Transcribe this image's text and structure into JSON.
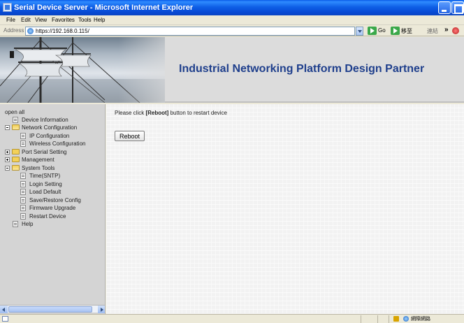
{
  "window": {
    "title": "Serial Device Server - Microsoft Internet Explorer"
  },
  "menu": [
    "File",
    "Edit",
    "View",
    "Favorites",
    "Tools",
    "Help"
  ],
  "address": {
    "label": "Address",
    "url": "https://192.168.0.115/",
    "go_label": "Go",
    "go2_label": "移至",
    "links_label": "連結"
  },
  "banner": {
    "title": "Industrial Networking Platform Design Partner"
  },
  "sidebar": {
    "items": [
      {
        "label": "open all",
        "kind": "text"
      },
      {
        "label": "Device Information",
        "kind": "page"
      },
      {
        "label": "Network Configuration",
        "kind": "folder-open"
      },
      {
        "label": "IP Configuration",
        "kind": "page"
      },
      {
        "label": "Wireless Configuration",
        "kind": "page"
      },
      {
        "label": "Port Serial Setting",
        "kind": "folder-closed"
      },
      {
        "label": "Management",
        "kind": "folder-closed"
      },
      {
        "label": "System Tools",
        "kind": "folder-open"
      },
      {
        "label": "Time(SNTP)",
        "kind": "page"
      },
      {
        "label": "Login Setting",
        "kind": "page"
      },
      {
        "label": "Load Default",
        "kind": "page"
      },
      {
        "label": "Save/Restore Config",
        "kind": "page"
      },
      {
        "label": "Firmware Upgrade",
        "kind": "page"
      },
      {
        "label": "Restart Device",
        "kind": "page"
      },
      {
        "label": "Help",
        "kind": "page"
      }
    ]
  },
  "main": {
    "msg_prefix": "Please click ",
    "msg_bold": "[Reboot]",
    "msg_suffix": " button to restart device",
    "reboot_label": "Reboot"
  },
  "status": {
    "zone": "網際網路"
  },
  "colors": {
    "banner_title": "#1f3f8c",
    "titlebar": "#0a5ce8"
  }
}
